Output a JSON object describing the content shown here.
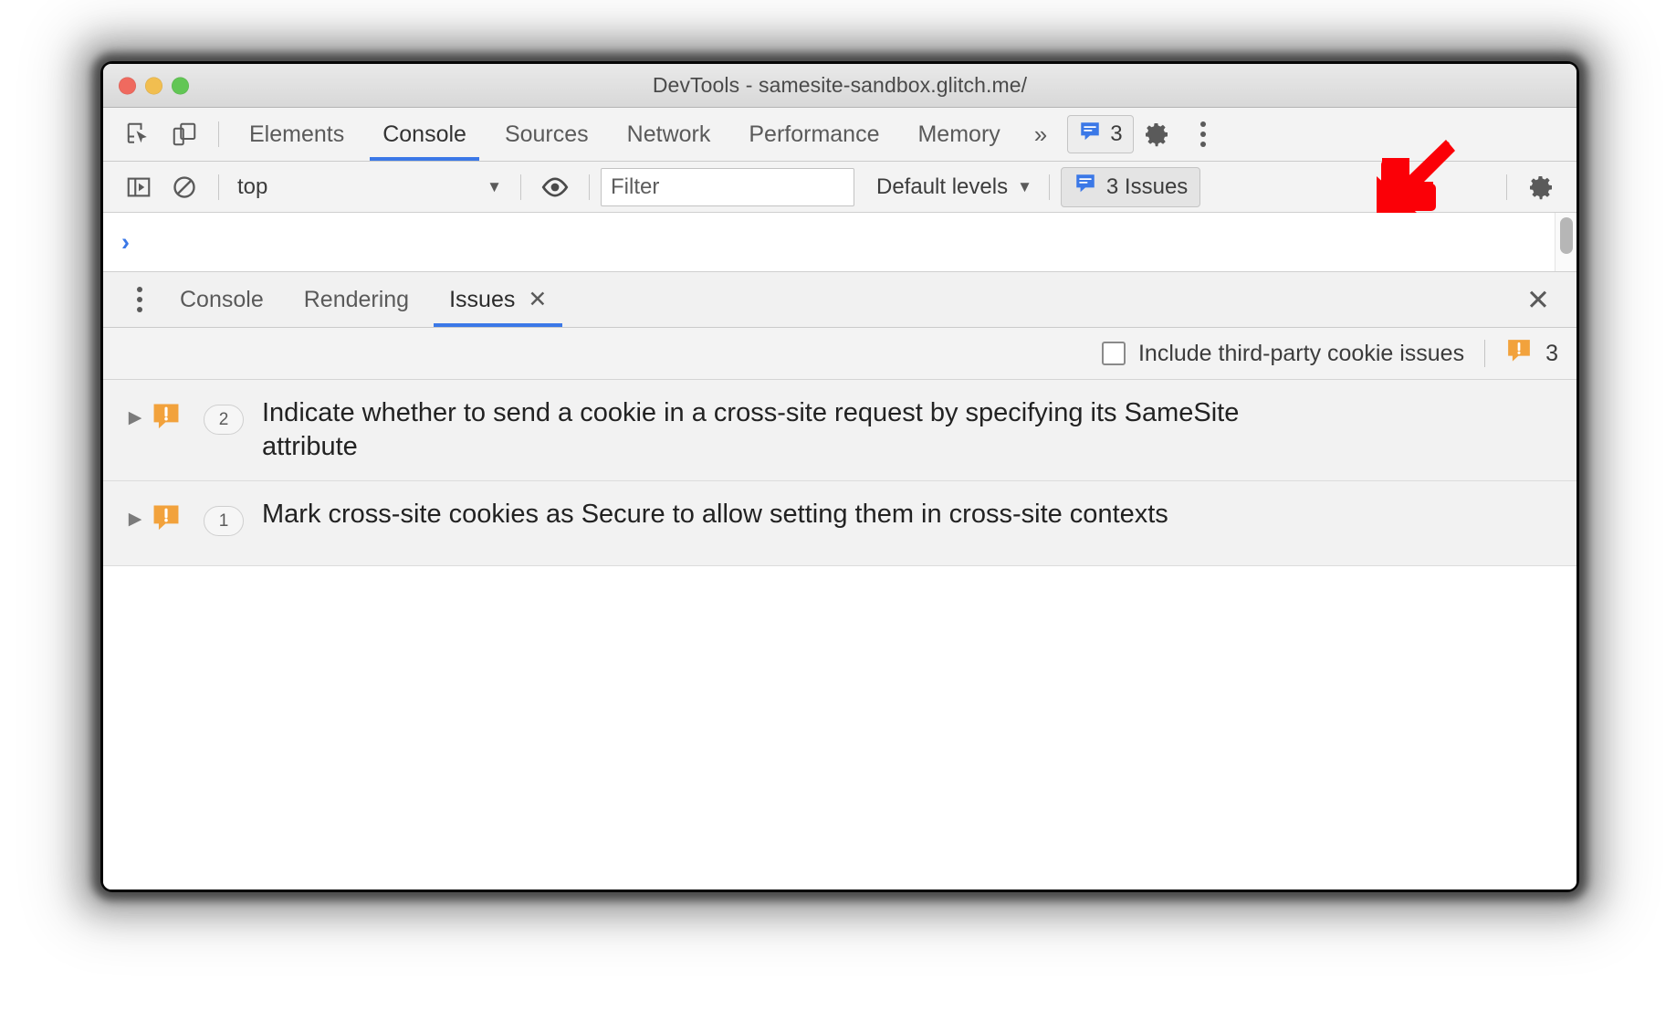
{
  "window": {
    "title": "DevTools - samesite-sandbox.glitch.me/",
    "traffic_lights": [
      "close",
      "minimize",
      "zoom"
    ]
  },
  "main_toolbar": {
    "icons": [
      {
        "name": "inspect-element-icon",
        "label": "Inspect element"
      },
      {
        "name": "device-toolbar-icon",
        "label": "Toggle device toolbar"
      }
    ],
    "tabs": [
      {
        "label": "Elements",
        "active": false
      },
      {
        "label": "Console",
        "active": true
      },
      {
        "label": "Sources",
        "active": false
      },
      {
        "label": "Network",
        "active": false
      },
      {
        "label": "Performance",
        "active": false
      },
      {
        "label": "Memory",
        "active": false
      }
    ],
    "more_tabs_label": "»",
    "issues_badge": {
      "count": "3",
      "icon": "issues-message-icon"
    },
    "settings_label": "Settings",
    "kebab_label": "Customize and control DevTools"
  },
  "console_toolbar": {
    "sidebar_toggle": "console-sidebar-icon",
    "clear_console": "clear-console-icon",
    "context": {
      "value": "top",
      "caret": "▼"
    },
    "live_expression": "eye-icon",
    "filter": {
      "value": "",
      "placeholder": "Filter"
    },
    "levels": {
      "label": "Default levels",
      "caret": "▼"
    },
    "issues_button": {
      "label": "3 Issues",
      "icon": "issues-message-icon",
      "active": true
    },
    "settings": "gear-icon"
  },
  "console_output": {
    "prompt": "›"
  },
  "drawer": {
    "menu_icon": "drawer-menu-icon",
    "tabs": [
      {
        "label": "Console",
        "active": false,
        "closable": false
      },
      {
        "label": "Rendering",
        "active": false,
        "closable": false
      },
      {
        "label": "Issues",
        "active": true,
        "closable": true,
        "close_glyph": "✕"
      }
    ],
    "close_glyph": "✕"
  },
  "issues_panel": {
    "third_party_checkbox": {
      "label": "Include third-party cookie issues",
      "checked": false
    },
    "total_count": "3",
    "total_icon": "warning-issue-icon",
    "issues": [
      {
        "expander": "▶",
        "icon": "warning-issue-icon",
        "count": "2",
        "title": "Indicate whether to send a cookie in a cross-site request by specifying its SameSite attribute"
      },
      {
        "expander": "▶",
        "icon": "warning-issue-icon",
        "count": "1",
        "title": "Mark cross-site cookies as Secure to allow setting them in cross-site contexts"
      }
    ]
  },
  "annotation": {
    "arrow": {
      "name": "red-callout-arrow",
      "direction": "down-left",
      "color": "#fb0007"
    }
  },
  "colors": {
    "accent_blue": "#3b78e7",
    "warning_orange": "#f2a23c",
    "annotation_red": "#fb0007",
    "window_chrome": "#f3f3f3"
  }
}
